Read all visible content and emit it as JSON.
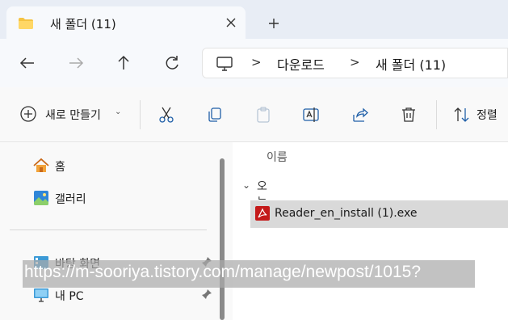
{
  "tab": {
    "title": "새 폴더 (11)",
    "icon": "folder-icon"
  },
  "address": {
    "crumbs": [
      "다운로드",
      "새 폴더 (11)"
    ],
    "separator": ">"
  },
  "toolbar": {
    "new_label": "새로 만들기",
    "new_chevron": "⌄",
    "sort_label": "정렬"
  },
  "nav": {
    "items": [
      {
        "label": "홈",
        "icon": "home-icon"
      },
      {
        "label": "갤러리",
        "icon": "gallery-icon"
      },
      {
        "label": "바탕 화면",
        "icon": "desktop-icon",
        "pinned": true
      },
      {
        "label": "내 PC",
        "icon": "pc-icon",
        "pinned": true
      }
    ]
  },
  "content": {
    "column_header": "이름",
    "group_label": "오늘",
    "group_chevron": "⌄",
    "files": [
      {
        "name": "Reader_en_install (1).exe",
        "icon": "pdf-icon",
        "selected": true
      }
    ]
  },
  "watermark": {
    "text": "https://m-sooriya.tistory.com/manage/newpost/1015?"
  },
  "colors": {
    "accent": "#0067c0",
    "selection": "#d9d9d9",
    "pdf_red": "#c41a1a",
    "folder_yellow": "#f5c342"
  }
}
